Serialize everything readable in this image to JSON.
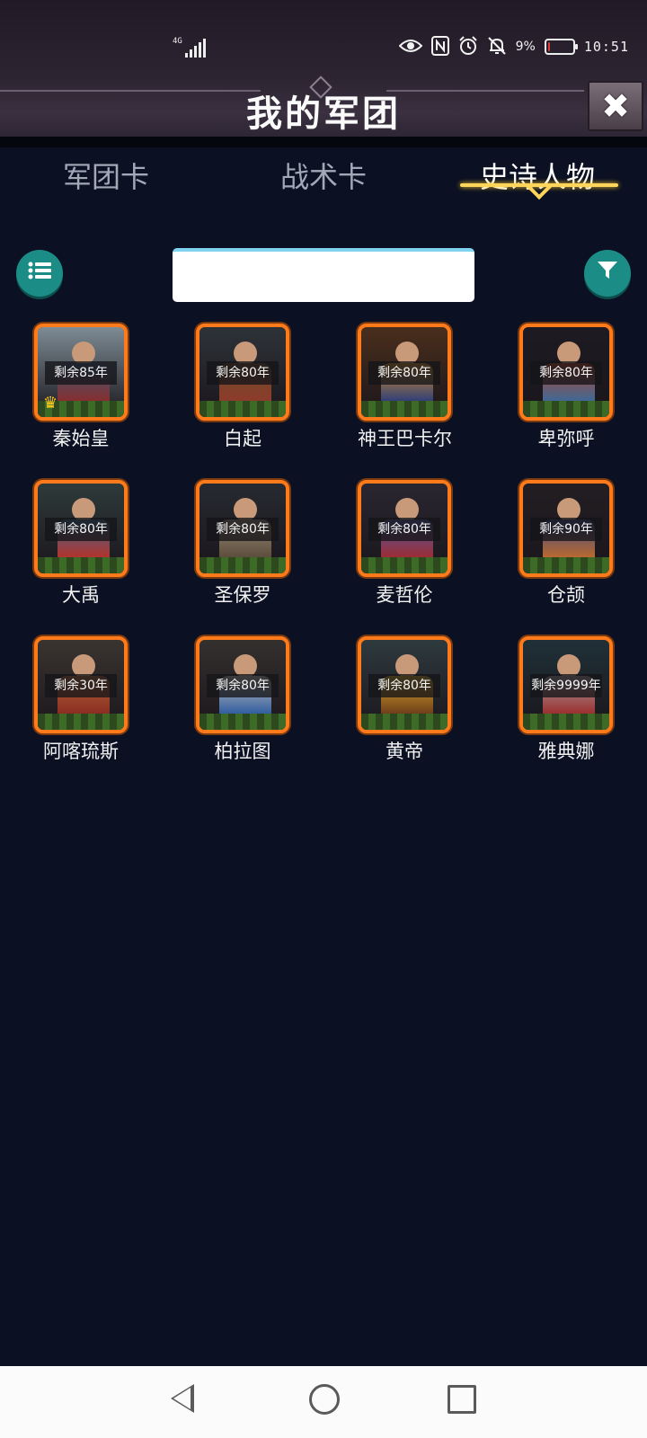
{
  "status_bar": {
    "network": "4G",
    "battery_percent": "9%",
    "battery_level": 0.09,
    "time": "10:51",
    "icons": [
      "eye-icon",
      "nfc-icon",
      "alarm-icon",
      "bell-off-icon",
      "battery-icon"
    ]
  },
  "title": "我的军团",
  "close_icon": "close-icon",
  "tabs": [
    {
      "label": "军团卡",
      "active": false
    },
    {
      "label": "战术卡",
      "active": false
    },
    {
      "label": "史诗人物",
      "active": true
    }
  ],
  "toolbar": {
    "list_icon": "list-icon",
    "filter_icon": "filter-icon",
    "search_value": ""
  },
  "colors": {
    "background": "#0b1022",
    "accent_teal": "#1b8d86",
    "card_border": "#ff7a1a",
    "tab_active": "#ffd55a"
  },
  "characters": [
    {
      "name": "秦始皇",
      "remaining": "剩余85年",
      "crown": true
    },
    {
      "name": "白起",
      "remaining": "剩余80年",
      "crown": false
    },
    {
      "name": "神王巴卡尔",
      "remaining": "剩余80年",
      "crown": false
    },
    {
      "name": "卑弥呼",
      "remaining": "剩余80年",
      "crown": false
    },
    {
      "name": "大禹",
      "remaining": "剩余80年",
      "crown": false
    },
    {
      "name": "圣保罗",
      "remaining": "剩余80年",
      "crown": false
    },
    {
      "name": "麦哲伦",
      "remaining": "剩余80年",
      "crown": false
    },
    {
      "name": "仓颉",
      "remaining": "剩余90年",
      "crown": false
    },
    {
      "name": "阿喀琉斯",
      "remaining": "剩余30年",
      "crown": false
    },
    {
      "name": "柏拉图",
      "remaining": "剩余80年",
      "crown": false
    },
    {
      "name": "黄帝",
      "remaining": "剩余80年",
      "crown": false
    },
    {
      "name": "雅典娜",
      "remaining": "剩余9999年",
      "crown": false
    }
  ],
  "nav": {
    "back_icon": "back-triangle-icon",
    "home_icon": "home-circle-icon",
    "recent_icon": "recent-square-icon"
  }
}
